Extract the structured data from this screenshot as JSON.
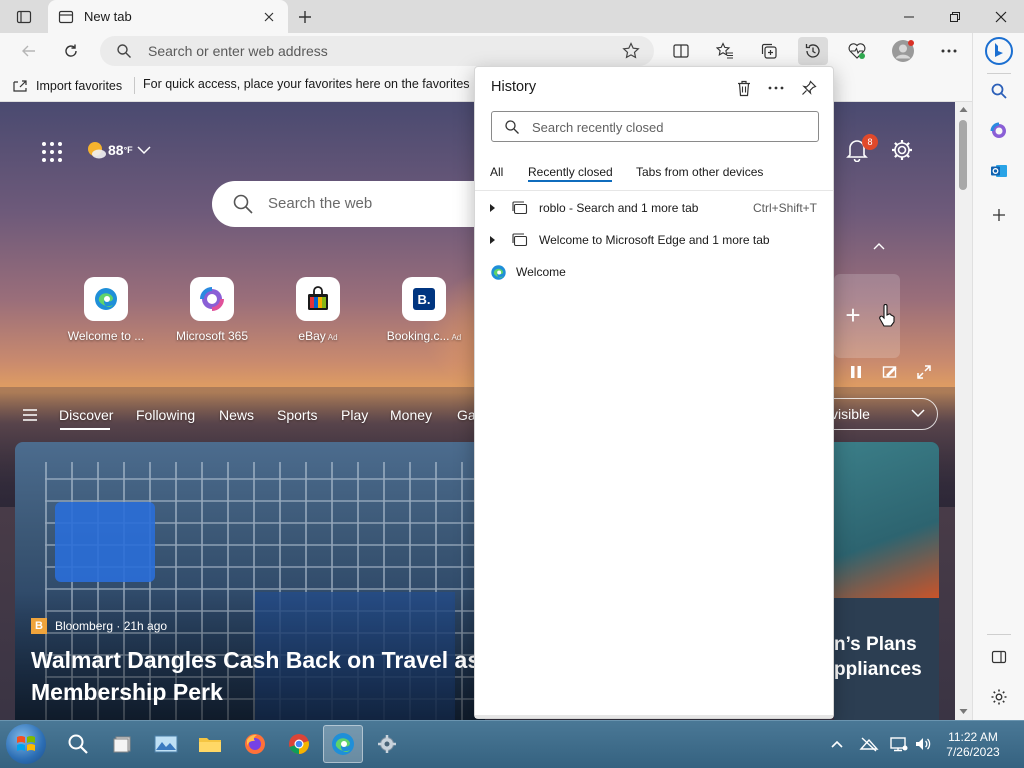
{
  "browser": {
    "tab_title": "New tab",
    "address_placeholder": "Search or enter web address"
  },
  "favorites_bar": {
    "import_label": "Import favorites",
    "message": "For quick access, place your favorites here on the favorites bar"
  },
  "ntp": {
    "temperature": "88",
    "temp_unit": "°F",
    "notification_count": "8",
    "search_placeholder": "Search the web",
    "quick_links": [
      {
        "label": "Welcome to ...",
        "ad": ""
      },
      {
        "label": "Microsoft 365",
        "ad": ""
      },
      {
        "label": "eBay",
        "ad": "Ad"
      },
      {
        "label": "Booking.c...",
        "ad": "Ad"
      }
    ],
    "nav": [
      "Discover",
      "Following",
      "News",
      "Sports",
      "Play",
      "Money",
      "Ga"
    ],
    "visibility_dropdown": "visible",
    "main_card": {
      "source": "Bloomberg · 21h ago",
      "source_initial": "B",
      "headline": "Walmart Dangles Cash Back on Travel as Membership Perk"
    },
    "right_card": {
      "headline_line1": "n’s Plans",
      "headline_line2": "ppliances"
    }
  },
  "history": {
    "title": "History",
    "search_placeholder": "Search recently closed",
    "tabs": [
      "All",
      "Recently closed",
      "Tabs from other devices"
    ],
    "active_tab": "Recently closed",
    "items": [
      {
        "label": "roblo - Search and 1 more tab",
        "shortcut": "Ctrl+Shift+T",
        "type": "window"
      },
      {
        "label": "Welcome to Microsoft Edge and 1 more tab",
        "shortcut": "",
        "type": "window"
      },
      {
        "label": "Welcome",
        "shortcut": "",
        "type": "edge-page"
      }
    ]
  },
  "taskbar": {
    "time": "11:22 AM",
    "date": "7/26/2023"
  },
  "colors": {
    "accent": "#0f6cbd",
    "badge": "#e0492b",
    "taskbar": "#356280"
  }
}
